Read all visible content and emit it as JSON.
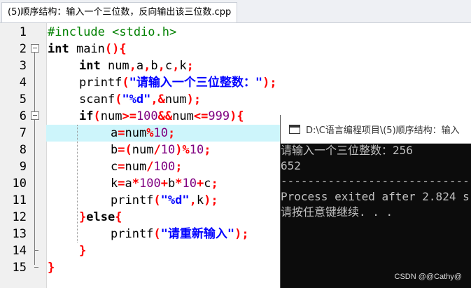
{
  "tab": {
    "title": "(5)顺序结构：输入一个三位数，反向输出该三位数.cpp"
  },
  "editor": {
    "lines": [
      {
        "n": "1"
      },
      {
        "n": "2"
      },
      {
        "n": "3"
      },
      {
        "n": "4"
      },
      {
        "n": "5"
      },
      {
        "n": "6"
      },
      {
        "n": "7"
      },
      {
        "n": "8"
      },
      {
        "n": "9"
      },
      {
        "n": "10"
      },
      {
        "n": "11"
      },
      {
        "n": "12"
      },
      {
        "n": "13"
      },
      {
        "n": "14"
      },
      {
        "n": "15"
      }
    ],
    "tokens": {
      "l1_pp": "#include <stdio.h>",
      "kw_int": "int",
      "l2_main": " main",
      "paren_open": "(",
      "paren_close": ")",
      "brace_open": "{",
      "brace_close": "}",
      "l3_vars": " num",
      "comma": ",",
      "a": "a",
      "b": "b",
      "c": "c",
      "k": "k",
      "num": "num",
      "semicolon": ";",
      "printf": "printf",
      "scanf": "scanf",
      "l4_str": "\"请输入一个三位整数：\"",
      "l5_fmt": "\"%d\"",
      "amp": "&",
      "kw_if": "if",
      "ge": ">=",
      "le": "<=",
      "and": "&&",
      "n100": "100",
      "n999": "999",
      "n10": "10",
      "eq": "=",
      "mod": "%",
      "div": "/",
      "mul": "*",
      "plus": "+",
      "kw_else": "else",
      "l13_str": "\"请重新输入\""
    }
  },
  "console": {
    "title": "D:\\C语言编程项目\\(5)顺序结构：输入",
    "lines": [
      "请输入一个三位整数：256",
      "652",
      "--------------------------------",
      "Process exited after 2.824 s",
      "请按任意键继续. . ."
    ]
  },
  "watermark": "CSDN @@Cathy@"
}
